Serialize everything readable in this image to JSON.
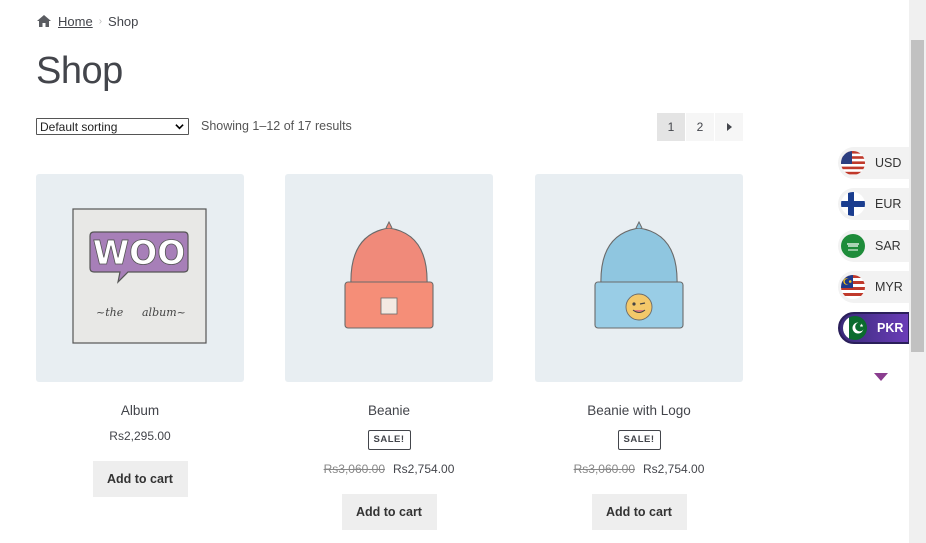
{
  "breadcrumb": {
    "home": "Home",
    "current": "Shop"
  },
  "page_title": "Shop",
  "toolbar": {
    "sort_selected": "Default sorting",
    "result_count": "Showing 1–12 of 17 results"
  },
  "pagination": {
    "pages": [
      "1",
      "2"
    ],
    "current": "1",
    "next_icon": "arrow-right-icon"
  },
  "products": [
    {
      "name": "Album",
      "price": "Rs2,295.00",
      "button": "Add to cart"
    },
    {
      "name": "Beanie",
      "sale_badge": "SALE!",
      "regular_price": "Rs3,060.00",
      "sale_price": "Rs2,754.00",
      "button": "Add to cart"
    },
    {
      "name": "Beanie with Logo",
      "sale_badge": "SALE!",
      "regular_price": "Rs3,060.00",
      "sale_price": "Rs2,754.00",
      "button": "Add to cart"
    }
  ],
  "currency_switcher": {
    "items": [
      {
        "code": "USD",
        "flag": "us-flag-icon"
      },
      {
        "code": "EUR",
        "flag": "fi-flag-icon"
      },
      {
        "code": "SAR",
        "flag": "sa-flag-icon"
      },
      {
        "code": "MYR",
        "flag": "my-flag-icon"
      },
      {
        "code": "PKR",
        "flag": "pk-flag-icon"
      }
    ],
    "active": "PKR",
    "more_icon": "chevron-down-icon"
  },
  "colors": {
    "accent_purple": "#6a3db8",
    "thumb_bg": "#e8eef2",
    "button_bg": "#eeeeee"
  }
}
